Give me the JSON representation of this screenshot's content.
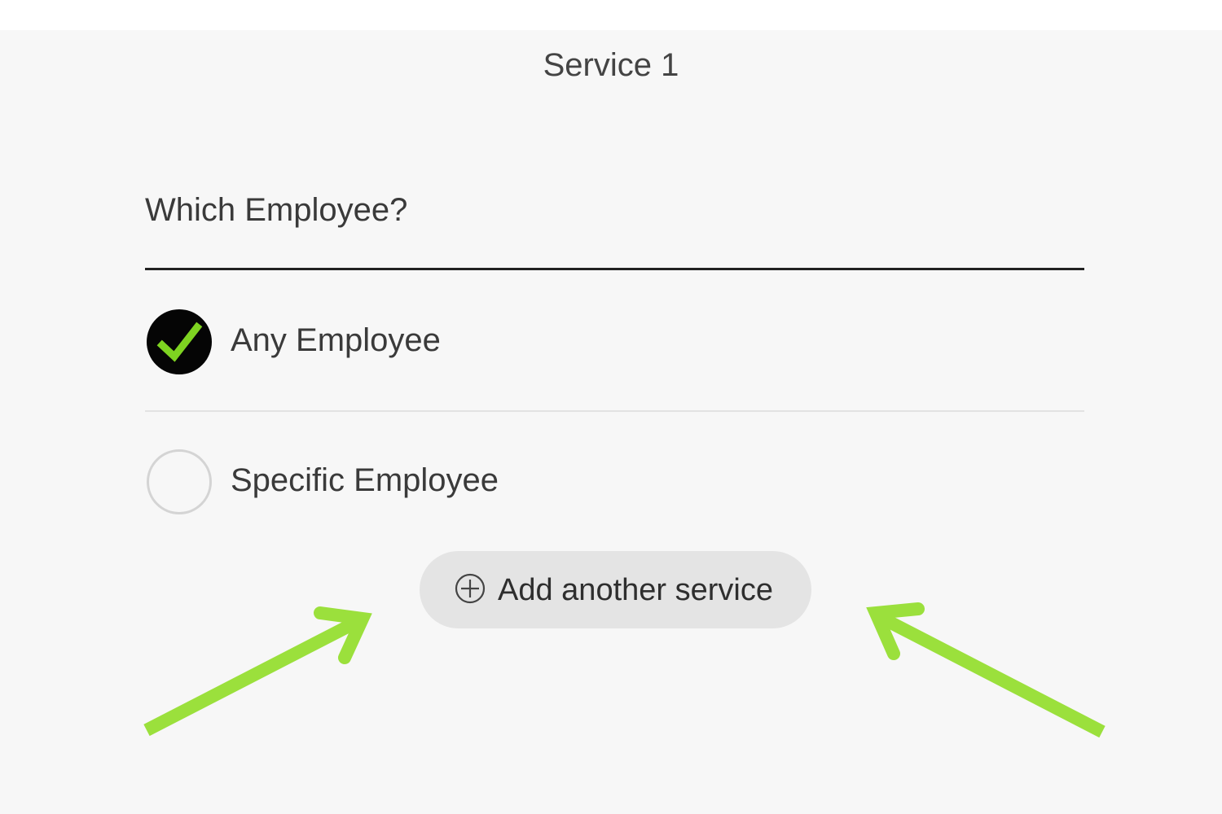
{
  "header": {
    "title": "Service 1"
  },
  "employee_choice": {
    "question": "Which Employee?",
    "options": [
      {
        "label": "Any Employee",
        "selected": true
      },
      {
        "label": "Specific Employee",
        "selected": false
      }
    ]
  },
  "actions": {
    "add_service_label": "Add another service",
    "add_icon": "plus-circle-icon"
  },
  "colors": {
    "background": "#f7f7f7",
    "check_accent": "#7ed321",
    "selected_radio": "#050505",
    "button_bg": "#e4e4e4",
    "annotation_arrow": "#9be03c"
  },
  "annotations": {
    "arrow_icon": "arrow-icon"
  }
}
